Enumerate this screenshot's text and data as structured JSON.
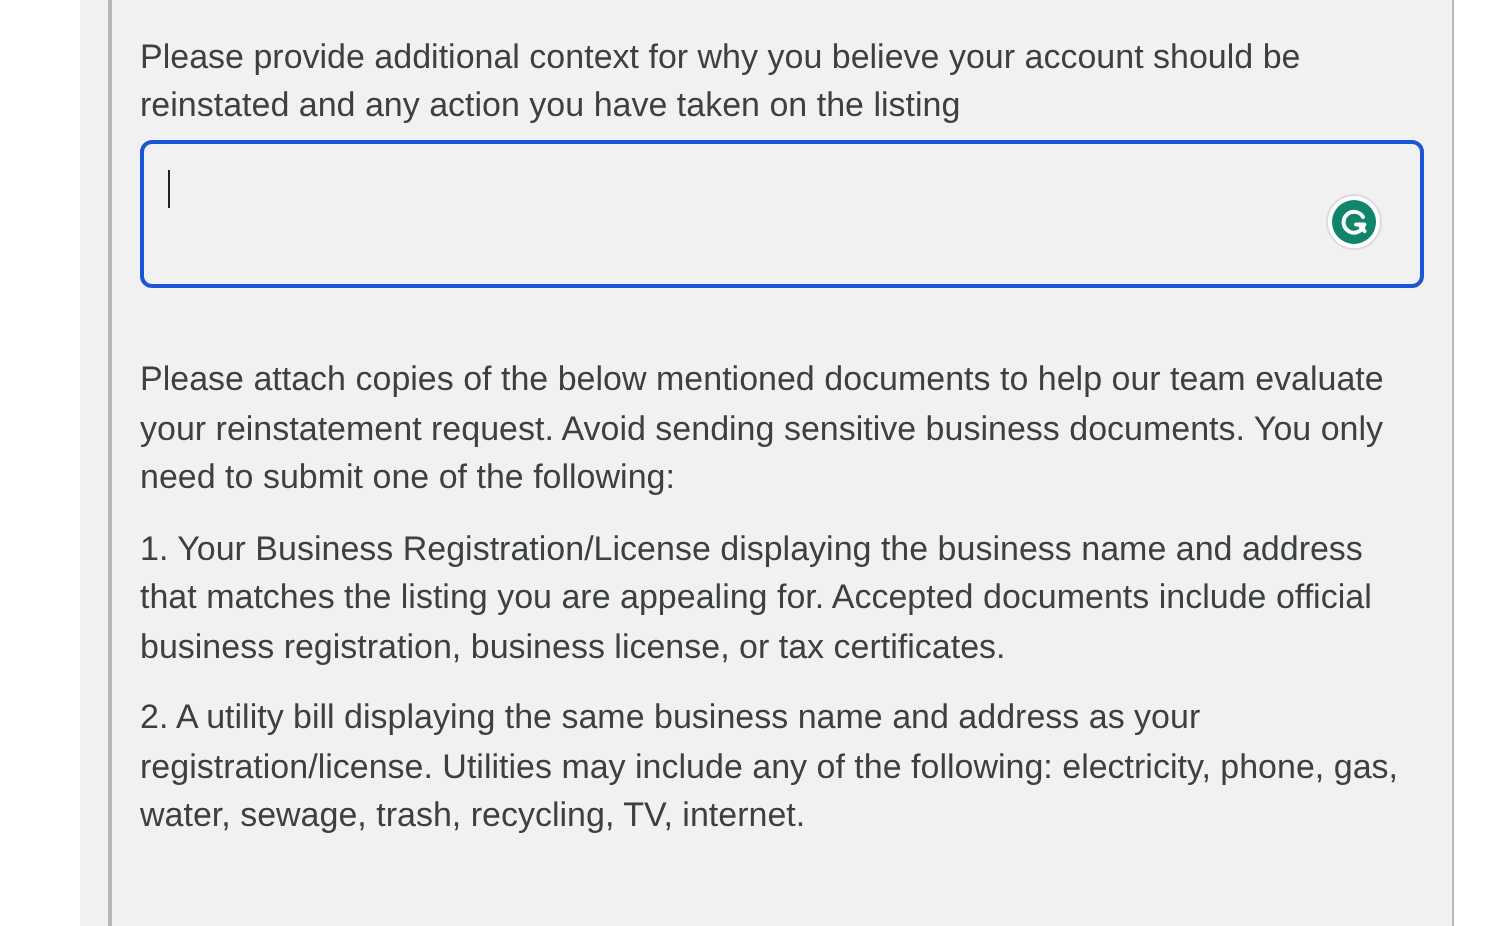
{
  "question": {
    "label": "Please provide additional context for why you believe your account should be reinstated and any action you have taken on the listing"
  },
  "answer_field": {
    "focused": true
  },
  "documents": {
    "intro": "Please attach copies of the below mentioned documents to help our team evaluate your reinstatement request. Avoid sending sensitive business documents. You only need to submit one of the following:",
    "items": [
      "1. Your Business Registration/License displaying the business name and address that matches the listing you are appealing for. Accepted documents include official business registration, business license, or tax certificates.",
      "2. A utility bill displaying the same business name and address as your registration/license. Utilities may include any of the following: electricity, phone, gas, water, sewage, trash, recycling, TV, internet."
    ]
  }
}
